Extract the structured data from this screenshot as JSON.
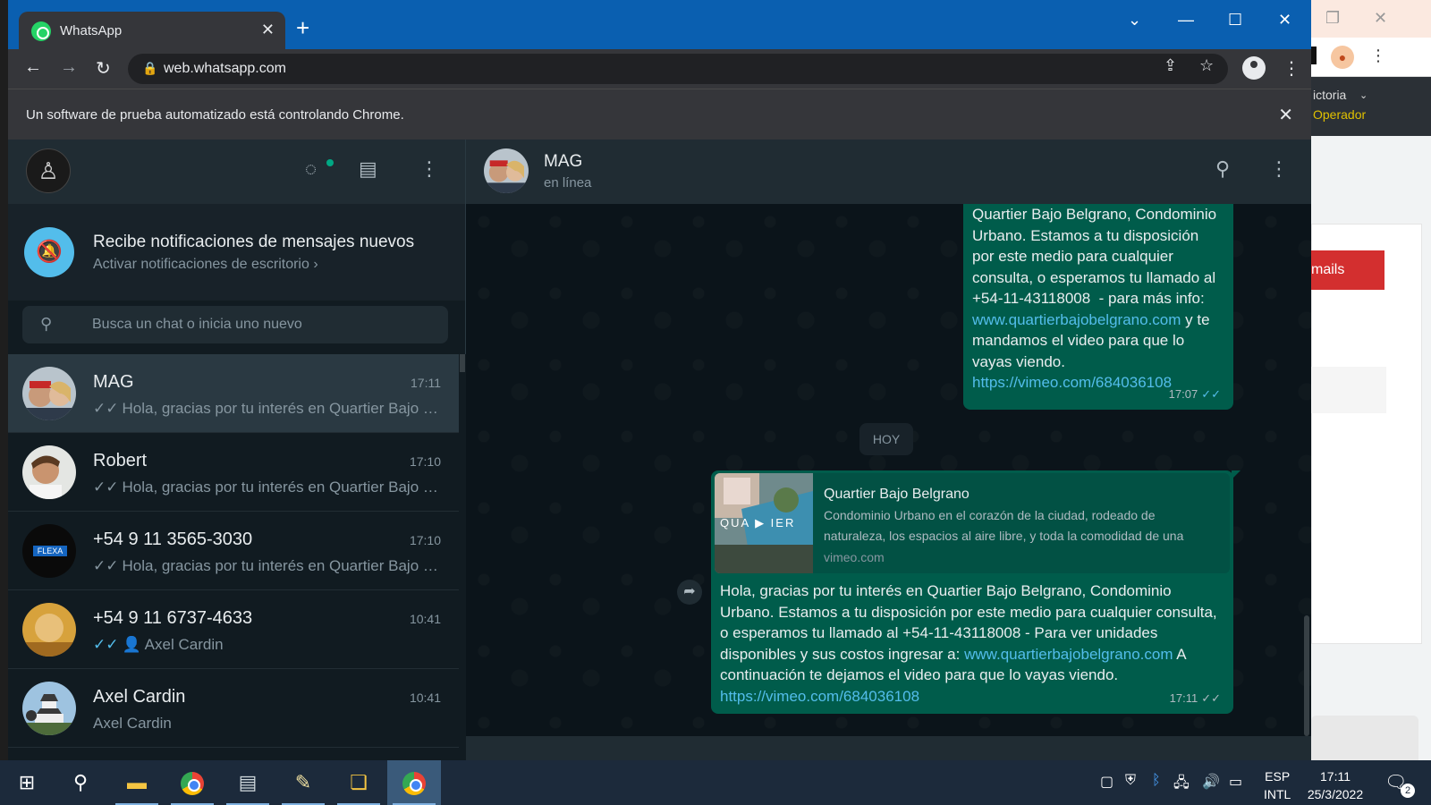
{
  "browser": {
    "tab_title": "WhatsApp",
    "url": "web.whatsapp.com",
    "infobar_text": "Un software de prueba automatizado está controlando Chrome."
  },
  "background_window": {
    "text1": "ictoria",
    "text2": "Operador",
    "button": "mails"
  },
  "left": {
    "notif_title": "Recibe notificaciones de mensajes nuevos",
    "notif_sub": "Activar notificaciones de escritorio ›",
    "search_placeholder": "Busca un chat o inicia uno nuevo"
  },
  "chats": [
    {
      "name": "MAG",
      "time": "17:11",
      "preview": "Hola, gracias por tu interés en Quartier Bajo Belgrano, Condominio Urbano",
      "tick": "✓✓"
    },
    {
      "name": "Robert",
      "time": "17:10",
      "preview": "Hola, gracias por tu interés en Quartier Bajo Belgrano, Condominio Urbano",
      "tick": "✓✓"
    },
    {
      "name": "+54 9 11 3565-3030",
      "time": "17:10",
      "preview": "Hola, gracias por tu interés en Quartier Bajo Belgrano, Condominio Urbano",
      "tick": "✓✓"
    },
    {
      "name": "+54 9 11 6737-4633",
      "time": "10:41",
      "preview": "Axel Cardin",
      "tick": "✓✓"
    },
    {
      "name": "Axel Cardin",
      "time": "10:41",
      "preview": "Axel Cardin",
      "tick": ""
    }
  ],
  "flexa_logo_text": "FLEXA",
  "conversation": {
    "contact_name": "MAG",
    "contact_status": "en línea",
    "msg1": {
      "text_before": "Quartier Bajo Belgrano, Condominio Urbano. Estamos a tu disposición por este medio para cualquier consulta, o esperamos tu llamado al +54-11-43118008  - para más info: ",
      "link1": "www.quartierbajobelgrano.com",
      "text_mid": " y te mandamos el video para que lo vayas viendo. ",
      "link2": "https://vimeo.com/684036108",
      "time": "17:07"
    },
    "date_chip": "HOY",
    "msg2": {
      "preview_title": "Quartier Bajo Belgrano",
      "preview_desc": "Condominio Urbano en el corazón de la ciudad, rodeado de naturaleza, los espacios al aire libre, y toda la comodidad de una",
      "preview_domain": "vimeo.com",
      "thumb_text": "QUA ▶ IER",
      "text_before": "Hola, gracias por tu interés en Quartier Bajo Belgrano, Condominio Urbano. Estamos a tu disposición por este medio para cualquier consulta, o esperamos tu llamado al +54-11-43118008  - Para ver unidades disponibles y sus costos ingresar a: ",
      "link1": "www.quartierbajobelgrano.com",
      "text_mid": " A continuación te dejamos el video para que lo vayas viendo. ",
      "link2": "https://vimeo.com/684036108",
      "time": "17:11"
    }
  },
  "taskbar": {
    "lang1": "ESP",
    "lang2": "INTL",
    "time": "17:11",
    "date": "25/3/2022",
    "notif_count": "2"
  },
  "icons": {
    "search": "search-icon",
    "status": "status-icon",
    "new_chat": "new-chat-icon",
    "menu": "menu-icon",
    "bell": "bell-off-icon"
  }
}
